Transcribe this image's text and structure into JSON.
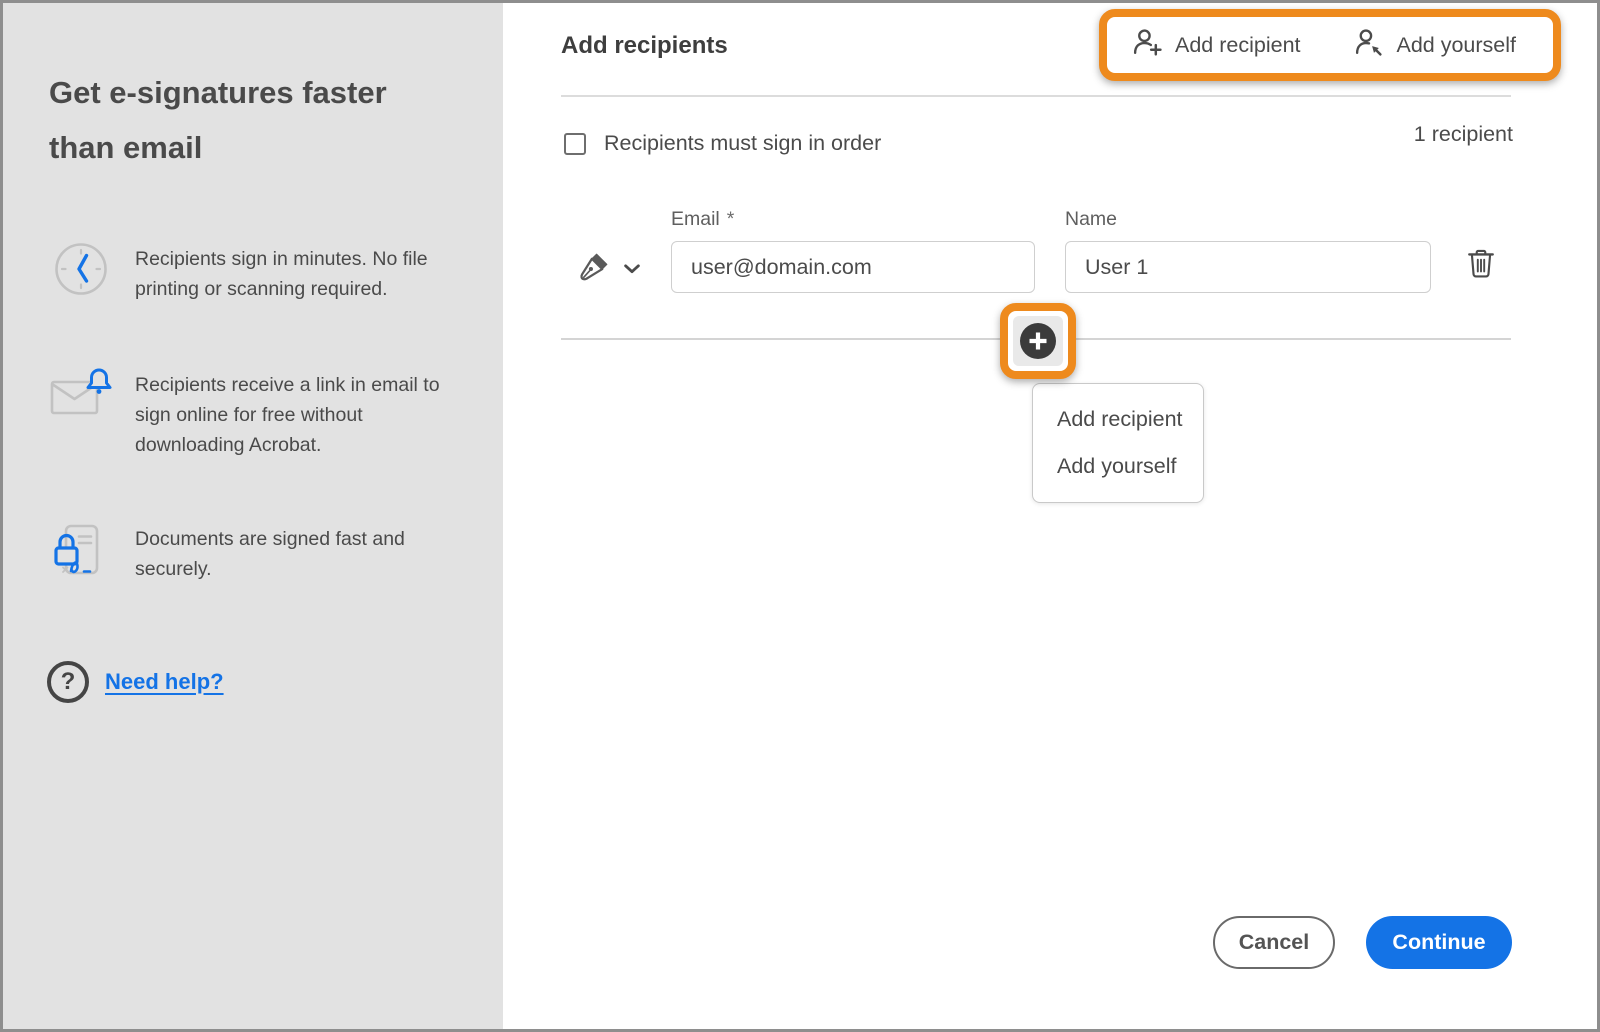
{
  "sidebar": {
    "heading": "Get e-signatures faster than email",
    "benefits": [
      {
        "icon": "clock-icon",
        "text": "Recipients sign in minutes. No file printing or scanning required."
      },
      {
        "icon": "email-notification-icon",
        "text": "Recipients receive a link in email to sign online for free without downloading Acrobat."
      },
      {
        "icon": "secure-document-icon",
        "text": "Documents are signed fast and securely."
      }
    ],
    "help": {
      "icon": "question-mark-icon",
      "glyph": "?",
      "label": "Need help?"
    }
  },
  "header": {
    "title": "Add recipients",
    "actions": [
      {
        "icon": "add-person-icon",
        "label": "Add recipient"
      },
      {
        "icon": "person-arrow-icon",
        "label": "Add yourself"
      }
    ]
  },
  "recipients_panel": {
    "sign_in_order_label": "Recipients must sign in order",
    "sign_in_order_checked": false,
    "count_label": "1 recipient",
    "row": {
      "email_label": "Email",
      "required_marker": "*",
      "email_value": "user@domain.com",
      "name_label": "Name",
      "name_value": "User 1"
    }
  },
  "add_menu": {
    "items": [
      {
        "label": "Add recipient"
      },
      {
        "label": "Add yourself"
      }
    ]
  },
  "footer": {
    "cancel_label": "Cancel",
    "continue_label": "Continue"
  },
  "colors": {
    "highlight_orange": "#EE8A1D",
    "primary_blue": "#1473E6",
    "sidebar_bg": "#E2E2E2"
  }
}
